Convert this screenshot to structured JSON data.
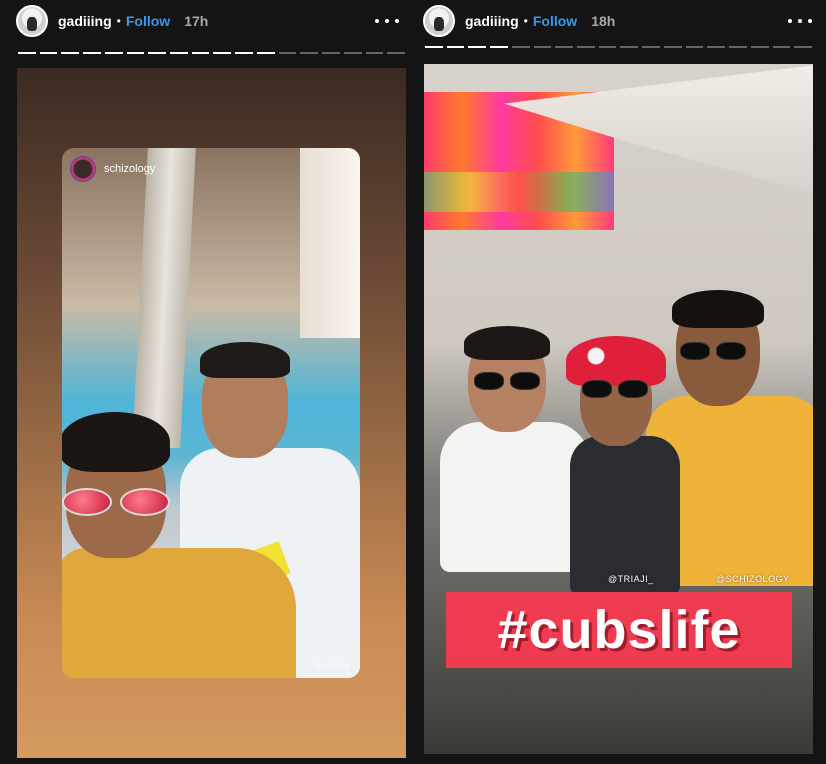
{
  "stories": [
    {
      "username": "gadiiing",
      "separator": "•",
      "follow_label": "Follow",
      "time": "17h",
      "progress": {
        "total": 18,
        "done": 12
      },
      "reshare": {
        "username": "schizology",
        "watermark": "@gadiiing"
      }
    },
    {
      "username": "gadiiing",
      "separator": "•",
      "follow_label": "Follow",
      "time": "18h",
      "progress": {
        "total": 18,
        "done": 4
      },
      "mentions": [
        "@TRIAJI_",
        "@SCHIZOLOGY"
      ],
      "hashtag": "#cubslife"
    }
  ],
  "icons": {
    "more": "more-options-icon",
    "avatar": "profile-avatar"
  },
  "colors": {
    "follow": "#3897f0",
    "hashtag_bg": "#ef3b4f",
    "background": "#141414"
  }
}
